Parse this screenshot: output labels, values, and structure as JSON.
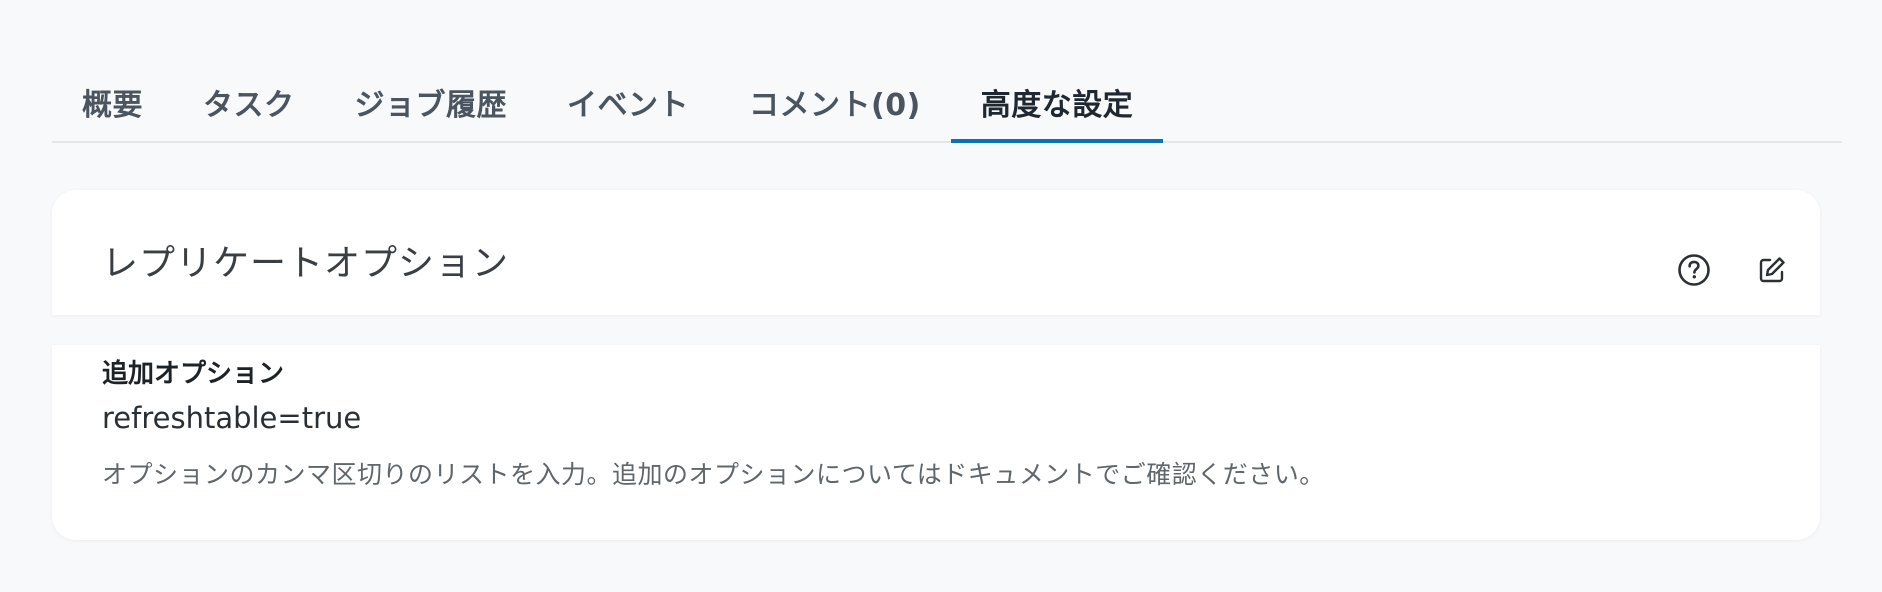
{
  "tabs": [
    {
      "label": "概要",
      "active": false
    },
    {
      "label": "タスク",
      "active": false
    },
    {
      "label": "ジョブ履歴",
      "active": false
    },
    {
      "label": "イベント",
      "active": false
    },
    {
      "label": "コメント(0)",
      "active": false
    },
    {
      "label": "高度な設定",
      "active": true
    }
  ],
  "section": {
    "title": "レプリケートオプション",
    "help_icon": "question-circle-icon",
    "edit_icon": "edit-pencil-icon"
  },
  "field": {
    "label": "追加オプション",
    "value": "refreshtable=true",
    "help_text": "オプションのカンマ区切りのリストを入力。追加のオプションについてはドキュメントでご確認ください。"
  },
  "colors": {
    "accent": "#0a73b8",
    "background": "#f8f9fa",
    "card": "#ffffff"
  }
}
